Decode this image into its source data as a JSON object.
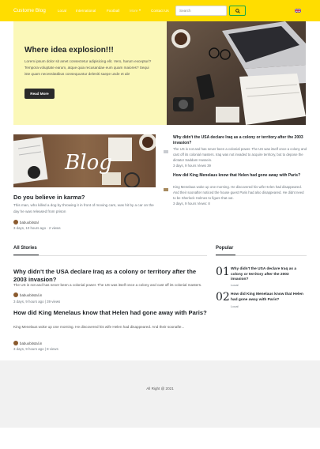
{
  "navbar": {
    "brand": "Custome Blog",
    "links": [
      "Local",
      "International",
      "Football"
    ],
    "more_label": "More",
    "contact_label": "Contact Us",
    "search_placeholder": "Search",
    "search_icon": "search-icon",
    "language_icon": "uk-flag-icon",
    "accent_color": "#ffdd00",
    "button_border_color": "#1aa748"
  },
  "hero": {
    "title": "Where idea explosion!!!",
    "text": "Lorem ipsum dolor sit amet consectetur adipisicing elit. Vero, harum excepturi? Tempora voluptate earum, atque quia recusandae eum quam maiores? Sequi iste quam necessitatibus consequuntur deleniti saepe unde et ab!",
    "button_label": "Read More",
    "background_color": "#fbf8b8"
  },
  "featured": {
    "title": "Do you believe in karma?",
    "text": "This man, who killed a dog by throwing it in front of moving cars, was hit by a car on the day he was released from prison",
    "author": "babuobitstal",
    "meta": "3 days, 10 hours ago · 2 views"
  },
  "side_posts": [
    {
      "title": "Why didn't the USA declare Iraq as a colony or territory after the 2003 invasion?",
      "text": "The US is not and has never been a colonial power. The US was itself once a colony and cast off its colonial masters. Iraq was not invaded to acquire territory, but to depose the dictator Saddam Hussein.",
      "meta": "3 days, 9 hours  Views 39"
    },
    {
      "title": "How did King Menelaus know that Helen had gone away with Paris?",
      "text": "King Menelaus woke up one morning. He discovered his wife Helen had disappeared. And their soonafter noticed the house guest Paris had also disappeared. He didnt need to be Sherlock Holmes to figure that out.",
      "meta": "3 days, 9 hours  Views: 8"
    }
  ],
  "all_stories": {
    "heading": "All Stories",
    "items": [
      {
        "title": "Why didn't the USA declare Iraq as a colony or territory after the 2003 invasion?",
        "text": "The US is not and has never been a colonial power. The US was itself once a colony and cast off its colonial masters.",
        "author": "babuobitstal.in",
        "meta": "3 days, 9 hours ago | 39 views"
      },
      {
        "title": "How did King Menelaus know that Helen had gone away with Paris?",
        "text": "King Menelaus woke up one morning. He discovered his wife Helen had disappeared. And their soonafte...",
        "author": "babuobitstal.in",
        "meta": "3 days, 9 hours ago | 8 views"
      }
    ]
  },
  "popular": {
    "heading": "Popular",
    "items": [
      {
        "number": "01",
        "title": "Why didn't the USA declare Iraq as a colony or territory after the 2003 invasion?",
        "category": "Local"
      },
      {
        "number": "02",
        "title": "How did King Menelaus know that Helen had gone away with Paris?",
        "category": "Local"
      }
    ]
  },
  "footer": {
    "text": "All Right @ 2021"
  },
  "images": {
    "hero": "laptop-desk-photo",
    "featured": "blog-desk-photo",
    "blog_word": "Blog"
  }
}
